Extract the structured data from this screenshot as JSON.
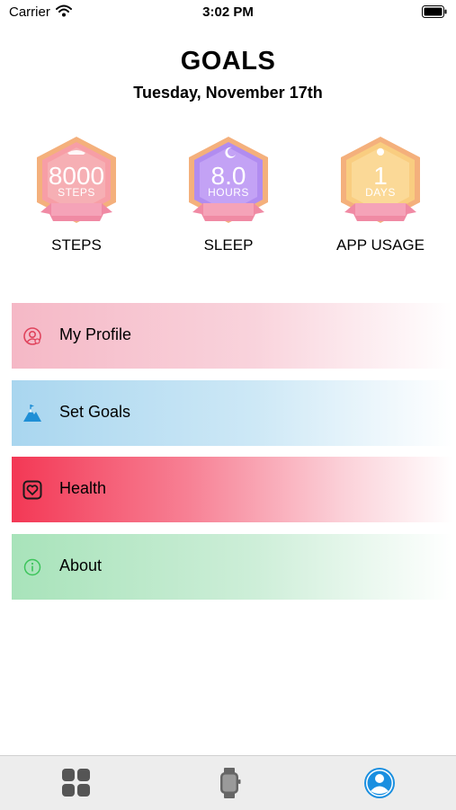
{
  "status_bar": {
    "carrier": "Carrier",
    "time": "3:02 PM"
  },
  "header": {
    "title": "GOALS",
    "date": "Tuesday, November 17th"
  },
  "badges": [
    {
      "value": "8000",
      "unit": "STEPS",
      "label": "STEPS",
      "color": "#f7a3a8"
    },
    {
      "value": "8.0",
      "unit": "HOURS",
      "label": "SLEEP",
      "color": "#b68ef0"
    },
    {
      "value": "1",
      "unit": "DAYS",
      "label": "APP USAGE",
      "color": "#f9cf7f"
    }
  ],
  "menu": [
    {
      "label": "My Profile",
      "icon": "profile-icon"
    },
    {
      "label": "Set Goals",
      "icon": "mountain-icon"
    },
    {
      "label": "Health",
      "icon": "heart-icon"
    },
    {
      "label": "About",
      "icon": "info-icon"
    }
  ],
  "tab_bar": {
    "items": [
      {
        "icon": "grid-icon"
      },
      {
        "icon": "watch-icon"
      },
      {
        "icon": "user-icon",
        "selected": true
      }
    ],
    "accent": "#1a8fe0"
  }
}
